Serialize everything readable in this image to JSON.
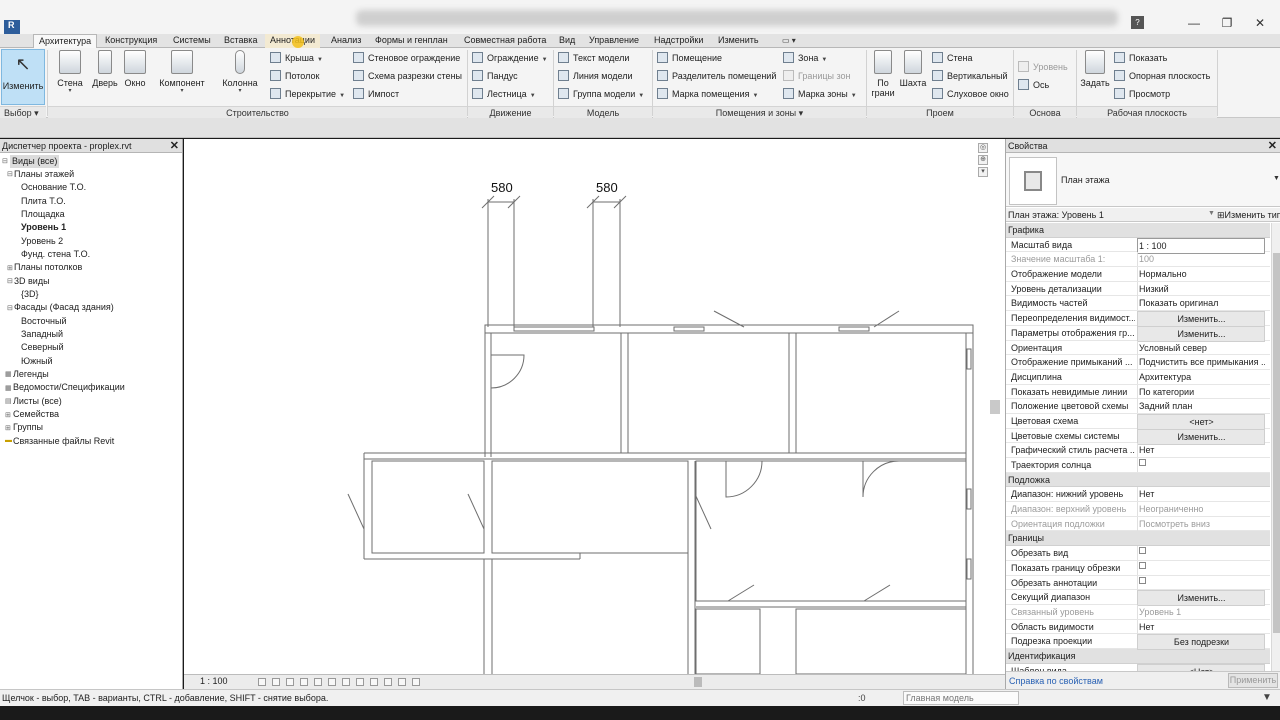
{
  "titlebar": {
    "logo": "R",
    "signin": "?",
    "minimize": "—",
    "restore": "❐",
    "close": "✕"
  },
  "tabs": [
    {
      "label": "Архитектура",
      "active": true
    },
    {
      "label": "Конструкция"
    },
    {
      "label": "Системы"
    },
    {
      "label": "Вставка"
    },
    {
      "label": "Аннотации",
      "hover": true
    },
    {
      "label": "Анализ"
    },
    {
      "label": "Формы и генплан"
    },
    {
      "label": "Совместная работа"
    },
    {
      "label": "Вид"
    },
    {
      "label": "Управление"
    },
    {
      "label": "Надстройки"
    },
    {
      "label": "Изменить"
    }
  ],
  "ribbon": {
    "modify": "Изменить",
    "selection": "Выбор",
    "build": {
      "title": "Строительство",
      "wall": "Стена",
      "door": "Дверь",
      "window": "Окно",
      "component": "Компонент",
      "column": "Колонна",
      "roof": "Крыша",
      "ceiling": "Потолок",
      "floor": "Перекрытие",
      "curtain_system": "Стеновое ограждение",
      "curtain_grid": "Схема разрезки стены",
      "mullion": "Импост"
    },
    "circulation": {
      "title": "Движение",
      "railing": "Ограждение",
      "ramp": "Пандус",
      "stair": "Лестница"
    },
    "model": {
      "title": "Модель",
      "model_text": "Текст модели",
      "model_line": "Линия модели",
      "model_group": "Группа модели"
    },
    "room": {
      "title": "Помещения и зоны",
      "room": "Помещение",
      "separator": "Разделитель помещений",
      "tag_room": "Марка помещения",
      "area": "Зона",
      "area_boundary": "Границы зон",
      "tag_area": "Марка зоны"
    },
    "opening": {
      "title": "Проем",
      "by_face_1": "По",
      "by_face_2": "грани",
      "shaft": "Шахта",
      "wall": "Стена",
      "vertical": "Вертикальный",
      "dormer": "Слуховое окно"
    },
    "datum": {
      "title": "Основа",
      "level": "Уровень",
      "grid": "Ось"
    },
    "workplane": {
      "title": "Рабочая плоскость",
      "set": "Задать",
      "show": "Показать",
      "ref_plane": "Опорная плоскость",
      "viewer": "Просмотр"
    }
  },
  "browser": {
    "title": "Диспетчер проекта - proplex.rvt",
    "close": "✕",
    "items": [
      "Виды (все)",
      "Планы этажей",
      "Основание Т.О.",
      "Плита Т.О.",
      "Площадка",
      "Уровень 1",
      "Уровень 2",
      "Фунд. стена Т.О.",
      "Планы потолков",
      "3D виды",
      "{3D}",
      "Фасады (Фасад здания)",
      "Восточный",
      "Западный",
      "Северный",
      "Южный",
      "Легенды",
      "Ведомости/Спецификации",
      "Листы (все)",
      "Семейства",
      "Группы",
      "Связанные файлы Revit"
    ]
  },
  "canvas": {
    "dim_left": "580",
    "dim_right": "580"
  },
  "viewbar": {
    "scale": "1 : 100"
  },
  "properties": {
    "title": "Свойства",
    "close": "✕",
    "type_name": "План этажа",
    "instance": "План этажа: Уровень 1",
    "edit_type": "Изменить тип",
    "groups": [
      {
        "name": "Графика",
        "rows": [
          {
            "n": "Масштаб вида",
            "v": "1 : 100",
            "kind": "input"
          },
          {
            "n": "Значение масштаба    1:",
            "v": "100",
            "kind": "disabled"
          },
          {
            "n": "Отображение модели",
            "v": "Нормально"
          },
          {
            "n": "Уровень детализации",
            "v": "Низкий"
          },
          {
            "n": "Видимость частей",
            "v": "Показать оригинал"
          },
          {
            "n": "Переопределения видимост...",
            "v": "Изменить...",
            "kind": "btn"
          },
          {
            "n": "Параметры отображения гр...",
            "v": "Изменить...",
            "kind": "btn"
          },
          {
            "n": "Ориентация",
            "v": "Условный север"
          },
          {
            "n": "Отображение примыканий ...",
            "v": "Подчистить все примыкания ..."
          },
          {
            "n": "Дисциплина",
            "v": "Архитектура"
          },
          {
            "n": "Показать невидимые линии",
            "v": "По категории"
          },
          {
            "n": "Положение цветовой схемы",
            "v": "Задний план"
          },
          {
            "n": "Цветовая схема",
            "v": "<нет>",
            "kind": "btn"
          },
          {
            "n": "Цветовые схемы системы",
            "v": "Изменить...",
            "kind": "btn"
          },
          {
            "n": "Графический стиль расчета ...",
            "v": "Нет"
          },
          {
            "n": "Траектория солнца",
            "v": "",
            "kind": "chk"
          }
        ]
      },
      {
        "name": "Подложка",
        "rows": [
          {
            "n": "Диапазон: нижний уровень",
            "v": "Нет"
          },
          {
            "n": "Диапазон: верхний уровень",
            "v": "Неограниченно",
            "kind": "disabled"
          },
          {
            "n": "Ориентация подложки",
            "v": "Посмотреть вниз",
            "kind": "disabled"
          }
        ]
      },
      {
        "name": "Границы",
        "rows": [
          {
            "n": "Обрезать вид",
            "v": "",
            "kind": "chk"
          },
          {
            "n": "Показать границу обрезки",
            "v": "",
            "kind": "chk"
          },
          {
            "n": "Обрезать аннотации",
            "v": "",
            "kind": "chk"
          },
          {
            "n": "Секущий диапазон",
            "v": "Изменить...",
            "kind": "btn"
          },
          {
            "n": "Связанный уровень",
            "v": "Уровень 1",
            "kind": "disabled"
          },
          {
            "n": "Область видимости",
            "v": "Нет"
          },
          {
            "n": "Подрезка проекции",
            "v": "Без подрезки",
            "kind": "btn"
          }
        ]
      },
      {
        "name": "Идентификация",
        "rows": [
          {
            "n": "Шаблон вида",
            "v": "<Нет>",
            "kind": "btn"
          }
        ]
      }
    ],
    "help_link": "Справка по свойствам",
    "apply": "Применить"
  },
  "statusbar": {
    "hint": "Щелчок - выбор, TAB - варианты, CTRL - добавление, SHIFT - снятие выбора.",
    "zero": ":0",
    "model": "Главная модель",
    "filter": "▼"
  }
}
